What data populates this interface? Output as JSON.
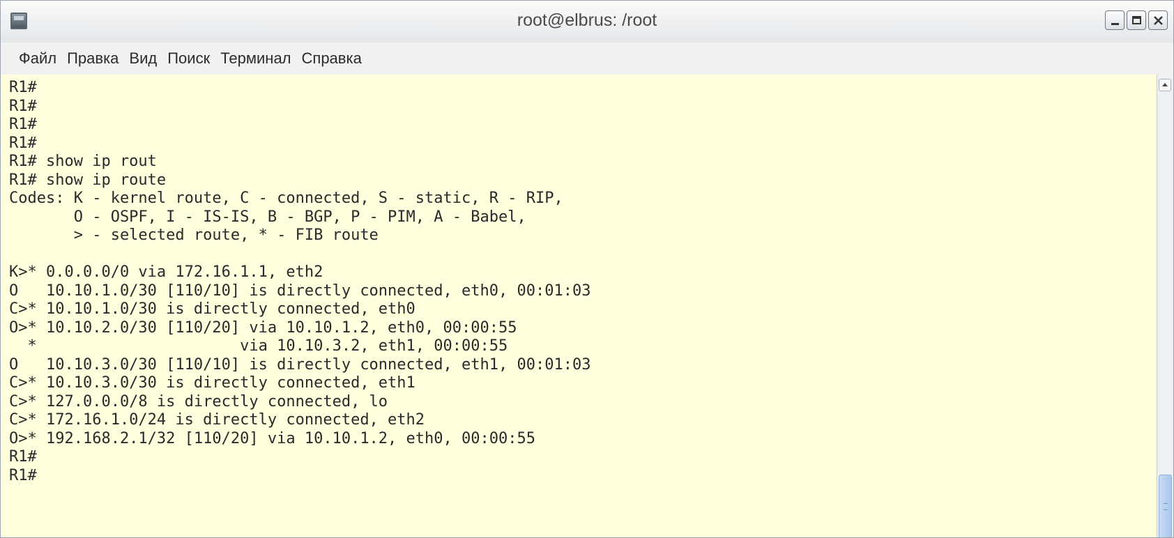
{
  "window": {
    "title": "root@elbrus: /root",
    "icons": {
      "app": "terminal-icon",
      "minimize": "minimize-icon",
      "maximize": "maximize-icon",
      "close": "close-icon"
    }
  },
  "menu": [
    "Файл",
    "Правка",
    "Вид",
    "Поиск",
    "Терминал",
    "Справка"
  ],
  "terminal": {
    "lines": [
      "R1#",
      "R1#",
      "R1#",
      "R1#",
      "R1# show ip rout",
      "R1# show ip route",
      "Codes: K - kernel route, C - connected, S - static, R - RIP,",
      "       O - OSPF, I - IS-IS, B - BGP, P - PIM, A - Babel,",
      "       > - selected route, * - FIB route",
      "",
      "K>* 0.0.0.0/0 via 172.16.1.1, eth2",
      "O   10.10.1.0/30 [110/10] is directly connected, eth0, 00:01:03",
      "C>* 10.10.1.0/30 is directly connected, eth0",
      "O>* 10.10.2.0/30 [110/20] via 10.10.1.2, eth0, 00:00:55",
      "  *                      via 10.10.3.2, eth1, 00:00:55",
      "O   10.10.3.0/30 [110/10] is directly connected, eth1, 00:01:03",
      "C>* 10.10.3.0/30 is directly connected, eth1",
      "C>* 127.0.0.0/8 is directly connected, lo",
      "C>* 172.16.1.0/24 is directly connected, eth2",
      "O>* 192.168.2.1/32 [110/20] via 10.10.1.2, eth0, 00:00:55",
      "R1#",
      "R1#"
    ],
    "background_color": "#ffffdd",
    "text_color": "#2a2a2a"
  },
  "scrollbar": {
    "up_icon": "arrow-up-icon"
  }
}
